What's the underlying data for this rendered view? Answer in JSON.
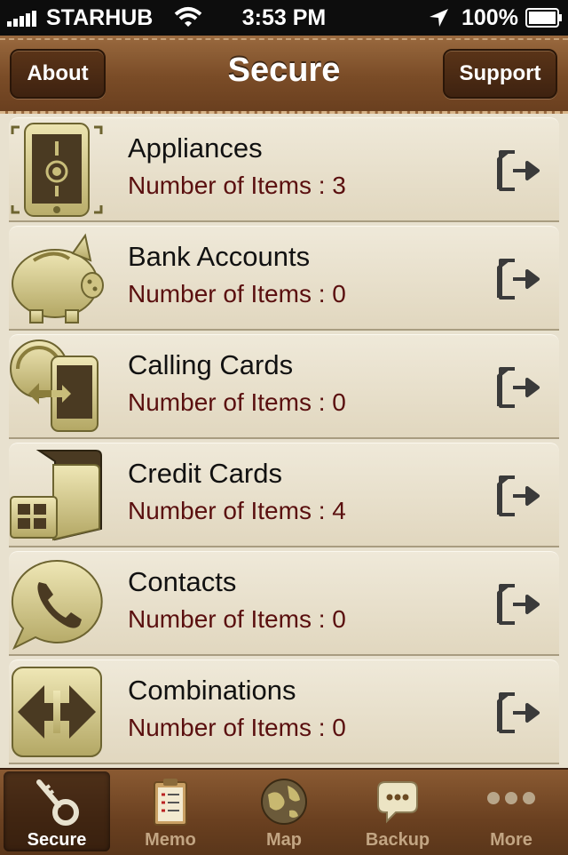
{
  "status_bar": {
    "carrier": "STARHUB",
    "time": "3:53 PM",
    "battery": "100%"
  },
  "nav": {
    "title": "Secure",
    "left_button": "About",
    "right_button": "Support"
  },
  "items": [
    {
      "name": "Appliances",
      "count_label": "Number of Items",
      "separator": " : ",
      "count": "3",
      "icon": "phone-device-icon"
    },
    {
      "name": "Bank Accounts",
      "count_label": "Number of Items",
      "separator": " : ",
      "count": "0",
      "icon": "piggy-bank-icon"
    },
    {
      "name": "Calling Cards",
      "count_label": "Number of Items",
      "separator": " : ",
      "count": "0",
      "icon": "calling-card-icon"
    },
    {
      "name": "Credit Cards",
      "count_label": "Number of Items",
      "separator": " : ",
      "count": "4",
      "icon": "credit-card-icon"
    },
    {
      "name": "Contacts",
      "count_label": "Number of Items",
      "separator": " : ",
      "count": "0",
      "icon": "phone-bubble-icon"
    },
    {
      "name": "Combinations",
      "count_label": "Number of Items",
      "separator": " : ",
      "count": "0",
      "icon": "combination-arrows-icon"
    }
  ],
  "tabs": [
    {
      "label": "Secure",
      "icon": "key-icon",
      "active": true
    },
    {
      "label": "Memo",
      "icon": "clipboard-icon",
      "active": false
    },
    {
      "label": "Map",
      "icon": "globe-icon",
      "active": false
    },
    {
      "label": "Backup",
      "icon": "chat-bubble-icon",
      "active": false
    },
    {
      "label": "More",
      "icon": "more-dots-icon",
      "active": false
    }
  ],
  "colors": {
    "leather": "#7a4c27",
    "row_bg": "#e8e1cf",
    "count_text": "#5a0f0f",
    "icon_gold": "#d6cc8c"
  }
}
